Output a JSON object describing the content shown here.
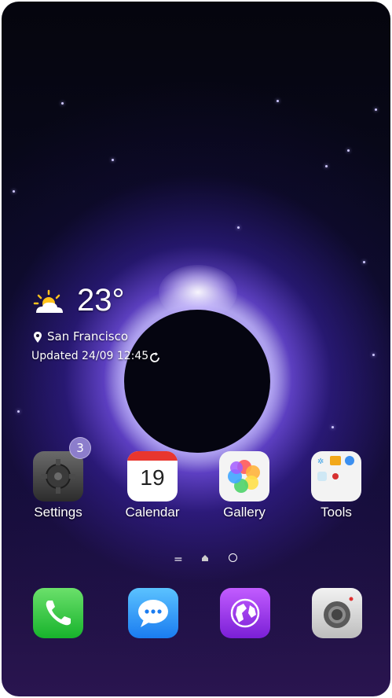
{
  "weather": {
    "temperature": "23°",
    "location": "San Francisco",
    "updated": "Updated 24/09 12:45"
  },
  "apps": [
    {
      "label": "Settings",
      "badge": "3"
    },
    {
      "label": "Calendar",
      "day": "19"
    },
    {
      "label": "Gallery"
    },
    {
      "label": "Tools"
    }
  ],
  "page_indicators": {
    "menu_glyph": "="
  },
  "dock": [
    "phone-icon",
    "messages-icon",
    "browser-icon",
    "camera-icon"
  ],
  "colors": {
    "calendar_red": "#e8362f",
    "badge": "#8c7dcc",
    "phone_green": "#17b32c",
    "messages_blue": "#1a7cf0",
    "browser_purple": "#7a1fd6"
  }
}
